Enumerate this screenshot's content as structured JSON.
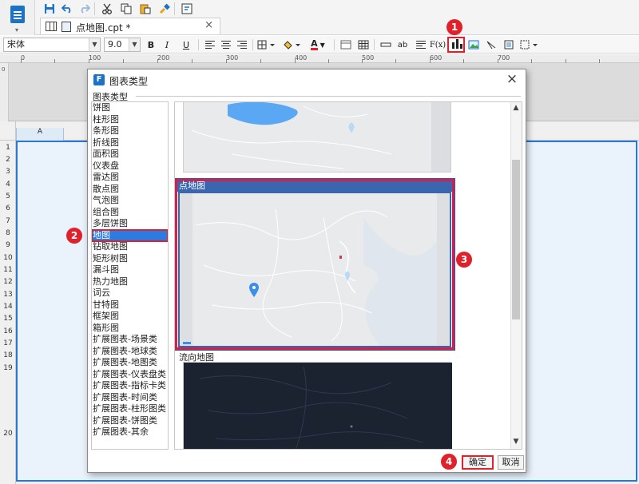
{
  "document_tab": {
    "title": "点地图.cpt *",
    "close": "×"
  },
  "format_toolbar": {
    "font_name": "宋体",
    "font_size": "9.0",
    "bold": "B",
    "italic": "I",
    "underline": "U",
    "font_color_letter": "A",
    "wrap_text": "ab",
    "formula": "F(x)"
  },
  "ruler": {
    "marks": [
      "0",
      "100",
      "200",
      "300",
      "400",
      "500",
      "600",
      "700"
    ],
    "vertical_mark": "0"
  },
  "sheet": {
    "column_header": "A",
    "rows": [
      "1",
      "2",
      "3",
      "4",
      "5",
      "6",
      "7",
      "8",
      "9",
      "10",
      "11",
      "12",
      "13",
      "14",
      "15",
      "16",
      "17",
      "18",
      "19",
      "20"
    ]
  },
  "dialog": {
    "title": "图表类型",
    "close": "×",
    "group_label": "图表类型",
    "chart_types": [
      "饼图",
      "柱形图",
      "条形图",
      "折线图",
      "面积图",
      "仪表盘",
      "雷达图",
      "散点图",
      "气泡图",
      "组合图",
      "多层饼图",
      "地图",
      "钻取地图",
      "矩形树图",
      "漏斗图",
      "热力地图",
      "词云",
      "甘特图",
      "框架图",
      "箱形图",
      "扩展图表-场景类",
      "扩展图表-地球类",
      "扩展图表-地图类",
      "扩展图表-仪表盘类",
      "扩展图表-指标卡类",
      "扩展图表-时间类",
      "扩展图表-柱形图类",
      "扩展图表-饼图类",
      "扩展图表-其余"
    ],
    "selected_type": "地图",
    "preview_selected_title": "点地图",
    "preview_next_title": "流向地图",
    "ok": "确定",
    "cancel": "取消",
    "scroll_up": "▲",
    "scroll_down": "▼"
  },
  "callouts": {
    "one": "1",
    "two": "2",
    "three": "3",
    "four": "4"
  },
  "colors": {
    "accent": "#2b7ce0",
    "highlight_red": "#e0202a",
    "map_land": "#e9eaec",
    "map_dark": "#1b2230",
    "marker_blue": "#3b8fe8",
    "sheet_bg": "#eaf3fc"
  }
}
